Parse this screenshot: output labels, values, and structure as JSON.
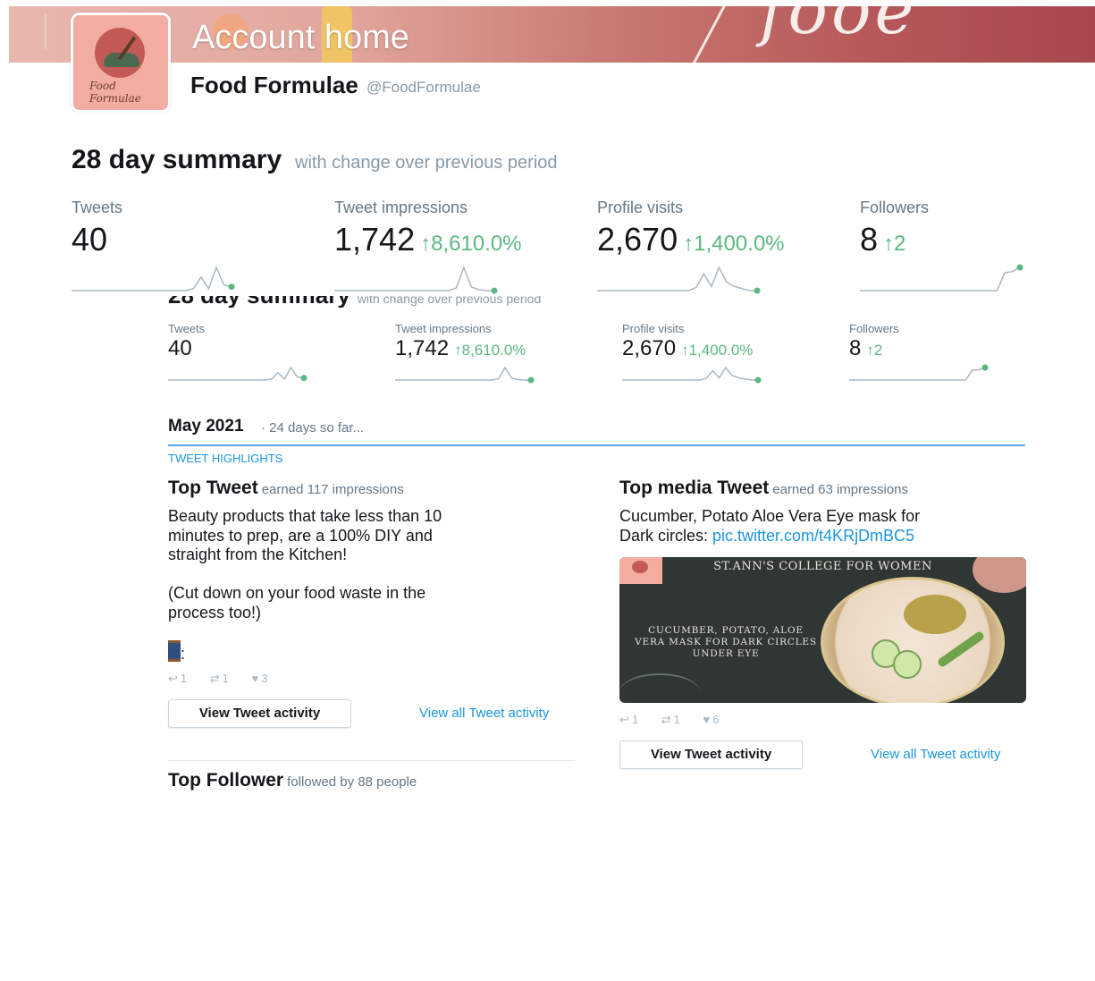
{
  "header": {
    "title": "Account home",
    "name": "Food Formulae",
    "handle": "@FoodFormulae"
  },
  "summary": {
    "title": "28 day summary",
    "subtitle": "with change over previous period",
    "stats": [
      {
        "label": "Tweets",
        "value": "40",
        "change": "",
        "trend": [
          1,
          1,
          1,
          1,
          1,
          1,
          1,
          1,
          1,
          1,
          1,
          1,
          1,
          1,
          1,
          1,
          1.2,
          2.4,
          1.2,
          3.4,
          1.6,
          1.4
        ]
      },
      {
        "label": "Tweet impressions",
        "value": "1,742",
        "change": "↑8,610.0%",
        "trend": [
          1,
          1,
          1,
          1,
          1,
          1,
          1,
          1,
          1,
          1,
          1,
          1,
          1,
          1,
          1,
          1,
          1.3,
          3.6,
          1.4,
          1.1,
          1,
          1
        ]
      },
      {
        "label": "Profile visits",
        "value": "2,670",
        "change": "↑1,400.0%",
        "trend": [
          1,
          1,
          1,
          1,
          1,
          1,
          1,
          1,
          1,
          1,
          1,
          1,
          1,
          1.3,
          2.6,
          1.4,
          3.2,
          1.8,
          1.4,
          1.2,
          1,
          1
        ]
      },
      {
        "label": "Followers",
        "value": "8",
        "change": "↑2",
        "trend": [
          1,
          1,
          1,
          1,
          1,
          1,
          1,
          1,
          1,
          1,
          1,
          1,
          1,
          1,
          1,
          1,
          1,
          1,
          1,
          2.7,
          2.8,
          3.2
        ]
      }
    ]
  },
  "month": {
    "label": "May 2021",
    "note": "· 24 days so far...",
    "section": "TWEET HIGHLIGHTS"
  },
  "top_tweet": {
    "title": "Top Tweet",
    "earned": "earned 117 impressions",
    "lines": [
      "Beauty products that take less than 10",
      "minutes to prep, are a 100% DIY and",
      "straight from the Kitchen!",
      "",
      "(Cut down on your food waste in the",
      "process too!)"
    ],
    "emoji_suffix": ":",
    "replies": "1",
    "retweets": "1",
    "likes": "3",
    "button": "View Tweet activity",
    "view_all": "View all Tweet activity"
  },
  "top_media": {
    "title": "Top media Tweet",
    "earned": "earned 63 impressions",
    "line1": "Cucumber, Potato Aloe Vera Eye mask for",
    "line2_prefix": "Dark circles: ",
    "link": "pic.twitter.com/t4KRjDmBC5",
    "image": {
      "college": "ST.ANN'S COLLEGE FOR WOMEN",
      "caption": "CUCUMBER, POTATO, ALOE VERA MASK FOR DARK CIRCLES UNDER EYE"
    },
    "replies": "1",
    "retweets": "1",
    "likes": "6",
    "button": "View Tweet activity",
    "view_all": "View all Tweet activity"
  },
  "top_follower": {
    "title": "Top Follower",
    "note": "followed by 88 people"
  },
  "icons": {
    "reply": "reply-icon",
    "retweet": "retweet-icon",
    "like": "heart-icon"
  },
  "colors": {
    "accent": "#1b95e0",
    "positive": "#5bb782",
    "rule": "#55acee",
    "sparkline": "#aab8c2",
    "sparkline_dot": "#5bb782"
  }
}
